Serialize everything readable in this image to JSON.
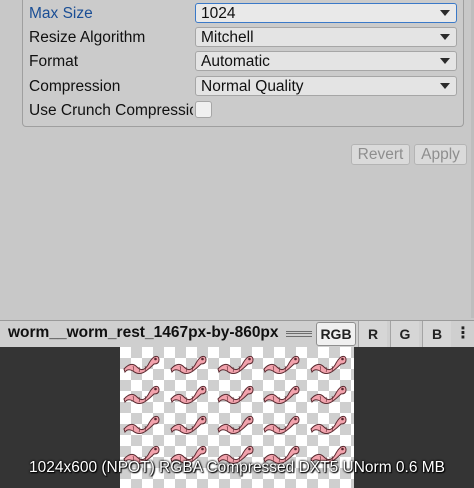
{
  "import_settings": {
    "max_size": {
      "label": "Max Size",
      "value": "1024"
    },
    "resize_algorithm": {
      "label": "Resize Algorithm",
      "value": "Mitchell"
    },
    "format": {
      "label": "Format",
      "value": "Automatic"
    },
    "compression": {
      "label": "Compression",
      "value": "Normal Quality"
    },
    "use_crunch": {
      "label": "Use Crunch Compressic",
      "checked": false
    }
  },
  "buttons": {
    "revert": "Revert",
    "apply": "Apply"
  },
  "preview": {
    "title": "worm__worm_rest_1467px-by-860px",
    "channels": [
      "RGB",
      "R",
      "G",
      "B"
    ],
    "selected_channel": "RGB",
    "info": "1024x600 (NPOT)  RGBA Compressed DXT5 UNorm   0.6 MB"
  },
  "colors": {
    "accent": "#3a79c8",
    "worm": "#f2a3ad",
    "worm_outline": "#5a2a30"
  }
}
